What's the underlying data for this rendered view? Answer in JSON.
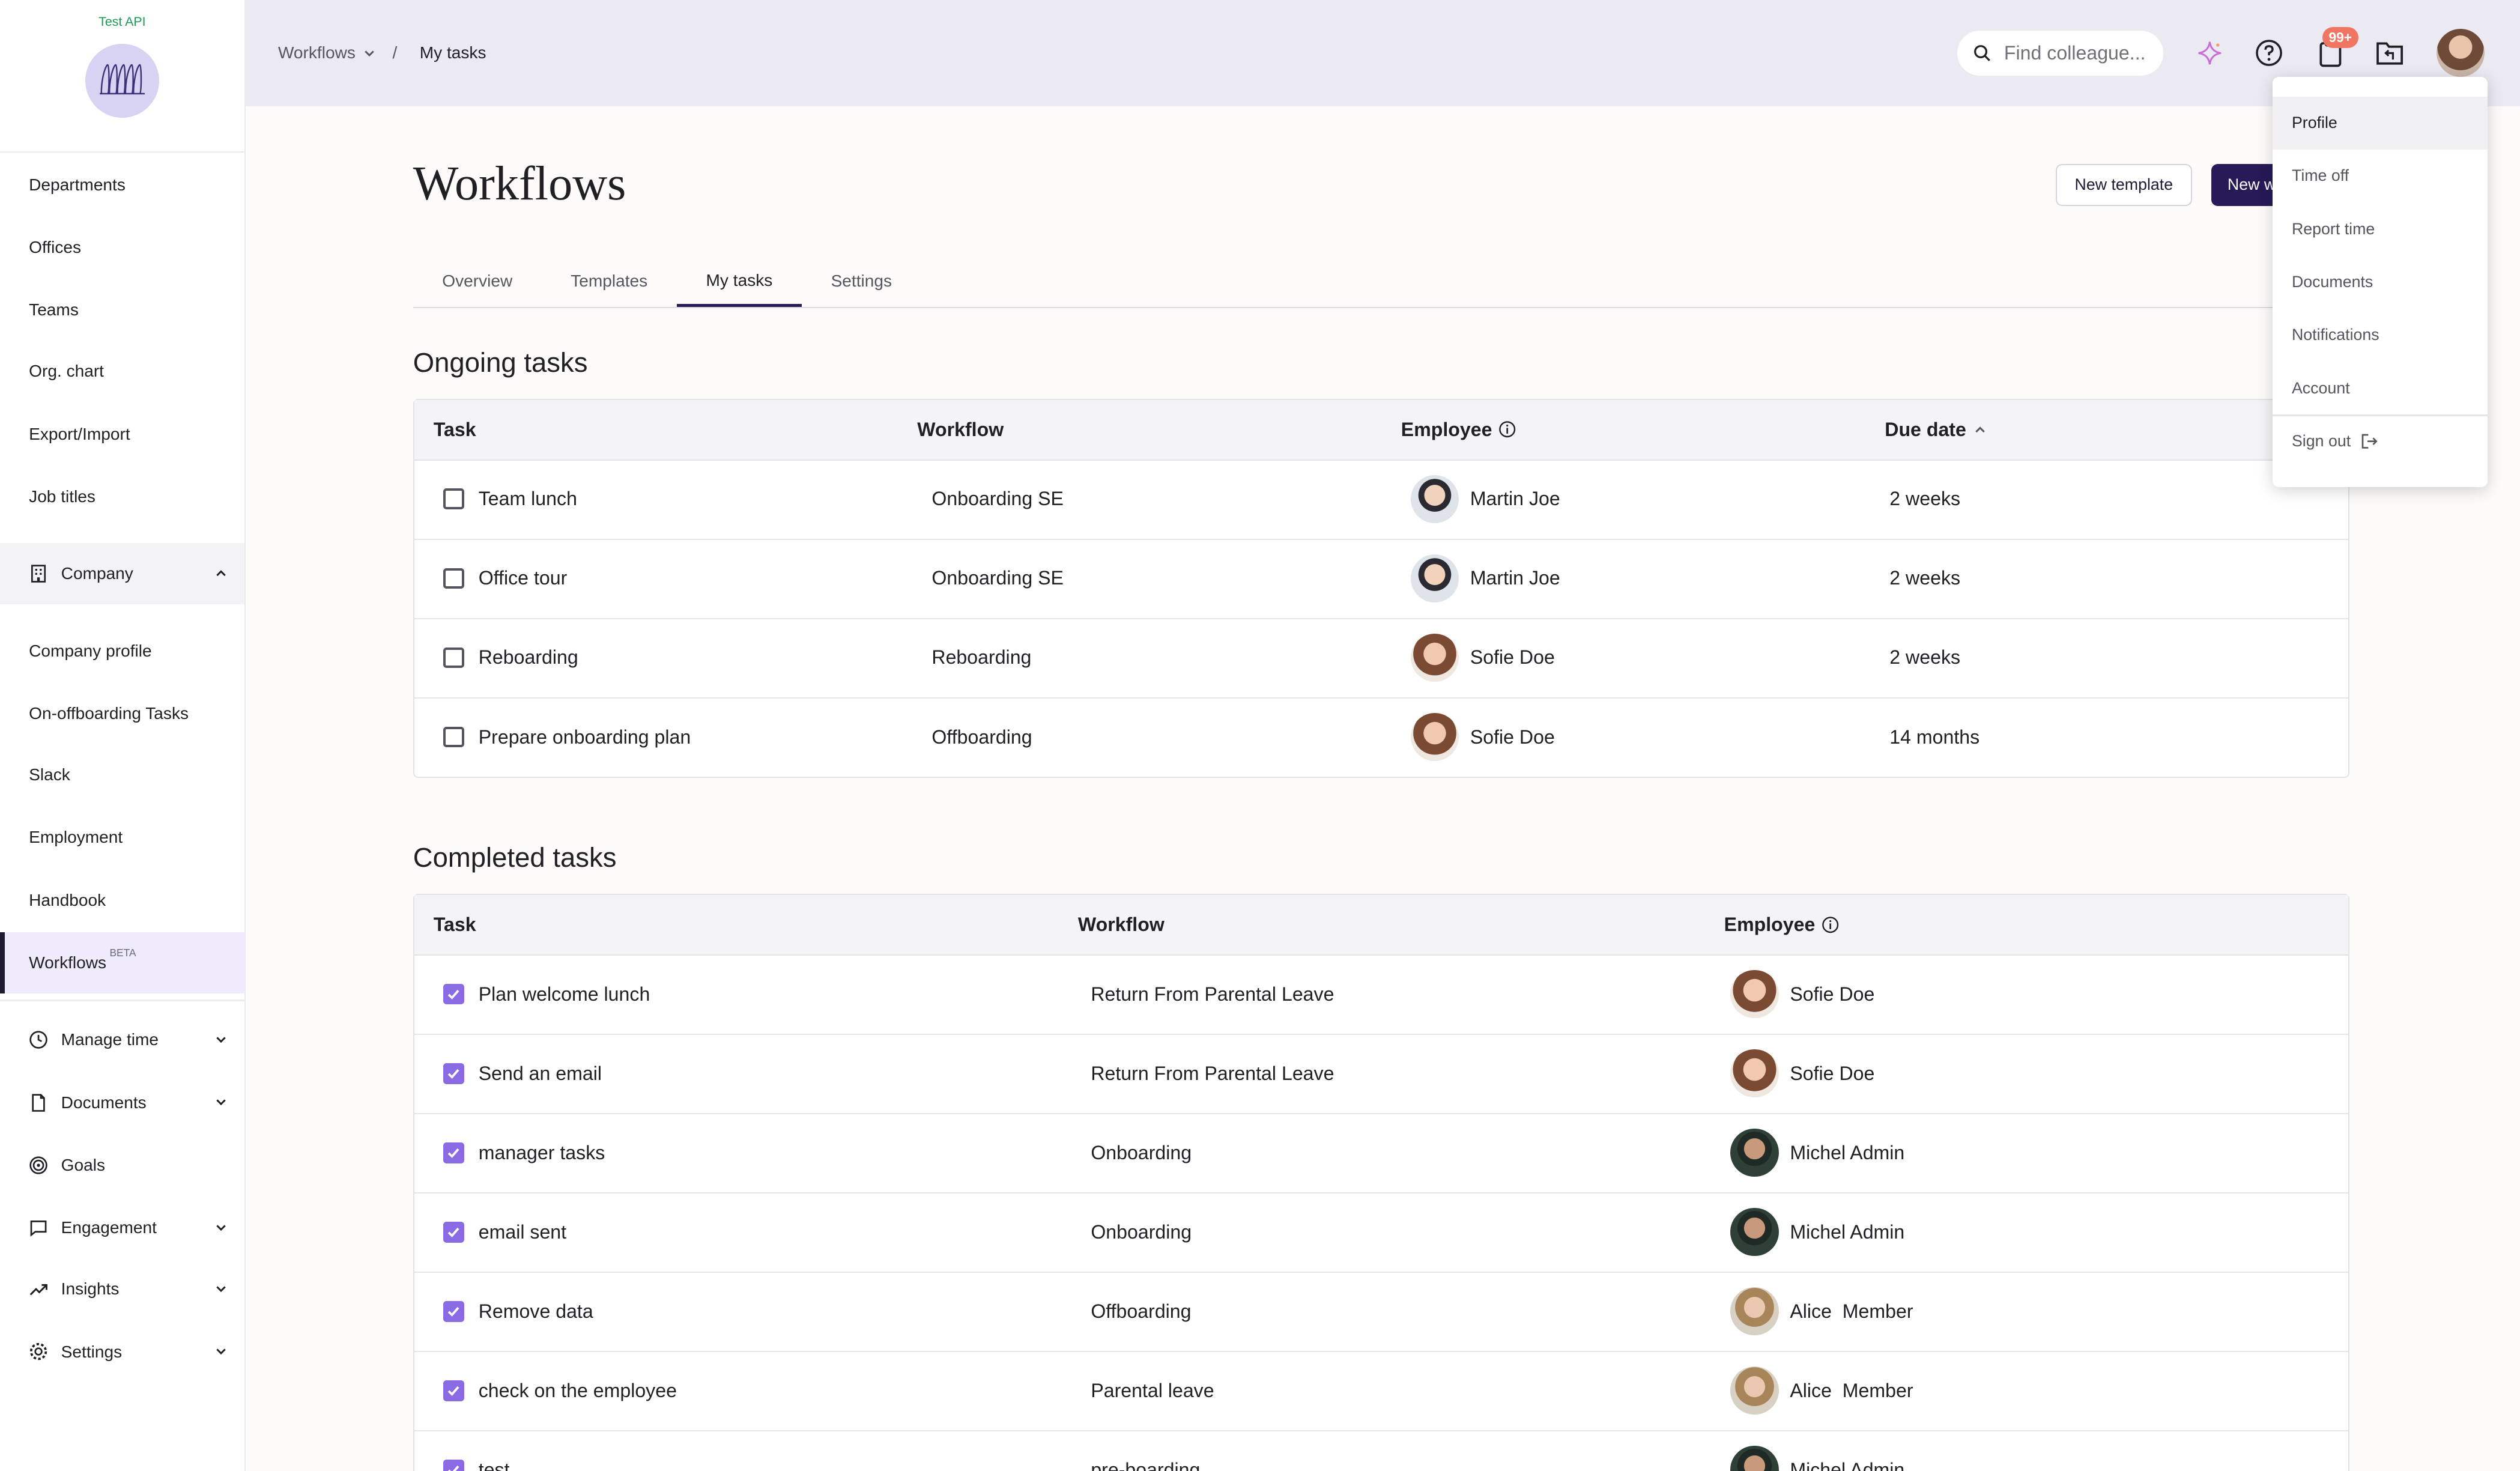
{
  "brand": {
    "name": "Test API"
  },
  "sidebar": {
    "top_items": [
      {
        "label": "Departments"
      },
      {
        "label": "Offices"
      },
      {
        "label": "Teams"
      },
      {
        "label": "Org. chart"
      },
      {
        "label": "Export/Import"
      },
      {
        "label": "Job titles"
      }
    ],
    "company_section": {
      "label": "Company",
      "expanded": true
    },
    "company_items": [
      {
        "label": "Company profile"
      },
      {
        "label": "On-offboarding Tasks"
      },
      {
        "label": "Slack"
      },
      {
        "label": "Employment"
      },
      {
        "label": "Handbook"
      },
      {
        "label": "Workflows",
        "badge": "BETA",
        "active": true
      }
    ],
    "bottom_items": [
      {
        "label": "Manage time",
        "icon": "clock-icon",
        "expandable": true
      },
      {
        "label": "Documents",
        "icon": "document-icon",
        "expandable": true
      },
      {
        "label": "Goals",
        "icon": "target-icon",
        "expandable": false
      },
      {
        "label": "Engagement",
        "icon": "chat-icon",
        "expandable": true
      },
      {
        "label": "Insights",
        "icon": "trend-icon",
        "expandable": true
      },
      {
        "label": "Settings",
        "icon": "gear-icon",
        "expandable": true
      }
    ]
  },
  "topbar": {
    "breadcrumb": {
      "parent": "Workflows",
      "separator": "/",
      "current": "My tasks"
    },
    "search": {
      "placeholder": "Find colleague...",
      "value": ""
    },
    "notification_badge": "99+"
  },
  "header": {
    "title": "Workflows",
    "new_template_label": "New template",
    "new_workflow_label": "New workflow"
  },
  "tabs": [
    {
      "label": "Overview"
    },
    {
      "label": "Templates"
    },
    {
      "label": "My tasks",
      "active": true
    },
    {
      "label": "Settings"
    }
  ],
  "ongoing": {
    "title": "Ongoing tasks",
    "columns": {
      "task": "Task",
      "workflow": "Workflow",
      "employee": "Employee",
      "due": "Due date"
    },
    "rows": [
      {
        "task": "Team lunch",
        "workflow": "Onboarding SE",
        "employee": "Martin Joe",
        "due": "2 weeks"
      },
      {
        "task": "Office tour",
        "workflow": "Onboarding SE",
        "employee": "Martin Joe",
        "due": "2 weeks"
      },
      {
        "task": "Reboarding",
        "workflow": "Reboarding",
        "employee": "Sofie Doe",
        "due": "2 weeks"
      },
      {
        "task": "Prepare onboarding plan",
        "workflow": "Offboarding",
        "employee": "Sofie Doe",
        "due": "14 months"
      }
    ]
  },
  "completed": {
    "title": "Completed tasks",
    "columns": {
      "task": "Task",
      "workflow": "Workflow",
      "employee": "Employee"
    },
    "rows": [
      {
        "task": "Plan welcome lunch",
        "workflow": "Return From Parental Leave",
        "employee": "Sofie Doe"
      },
      {
        "task": "Send an email",
        "workflow": "Return From Parental Leave",
        "employee": "Sofie Doe"
      },
      {
        "task": "manager tasks",
        "workflow": "Onboarding",
        "employee": "Michel Admin"
      },
      {
        "task": "email sent",
        "workflow": "Onboarding",
        "employee": "Michel Admin"
      },
      {
        "task": "Remove data",
        "workflow": "Offboarding",
        "employee": "Alice  Member"
      },
      {
        "task": "check on the employee",
        "workflow": "Parental leave",
        "employee": "Alice  Member"
      },
      {
        "task": "test",
        "workflow": "pre-boarding",
        "employee": "Michel Admin"
      }
    ]
  },
  "user_menu": {
    "items": [
      {
        "label": "Profile"
      },
      {
        "label": "Time off"
      },
      {
        "label": "Report time"
      },
      {
        "label": "Documents"
      },
      {
        "label": "Notifications"
      },
      {
        "label": "Account"
      }
    ],
    "sign_out_label": "Sign out"
  }
}
